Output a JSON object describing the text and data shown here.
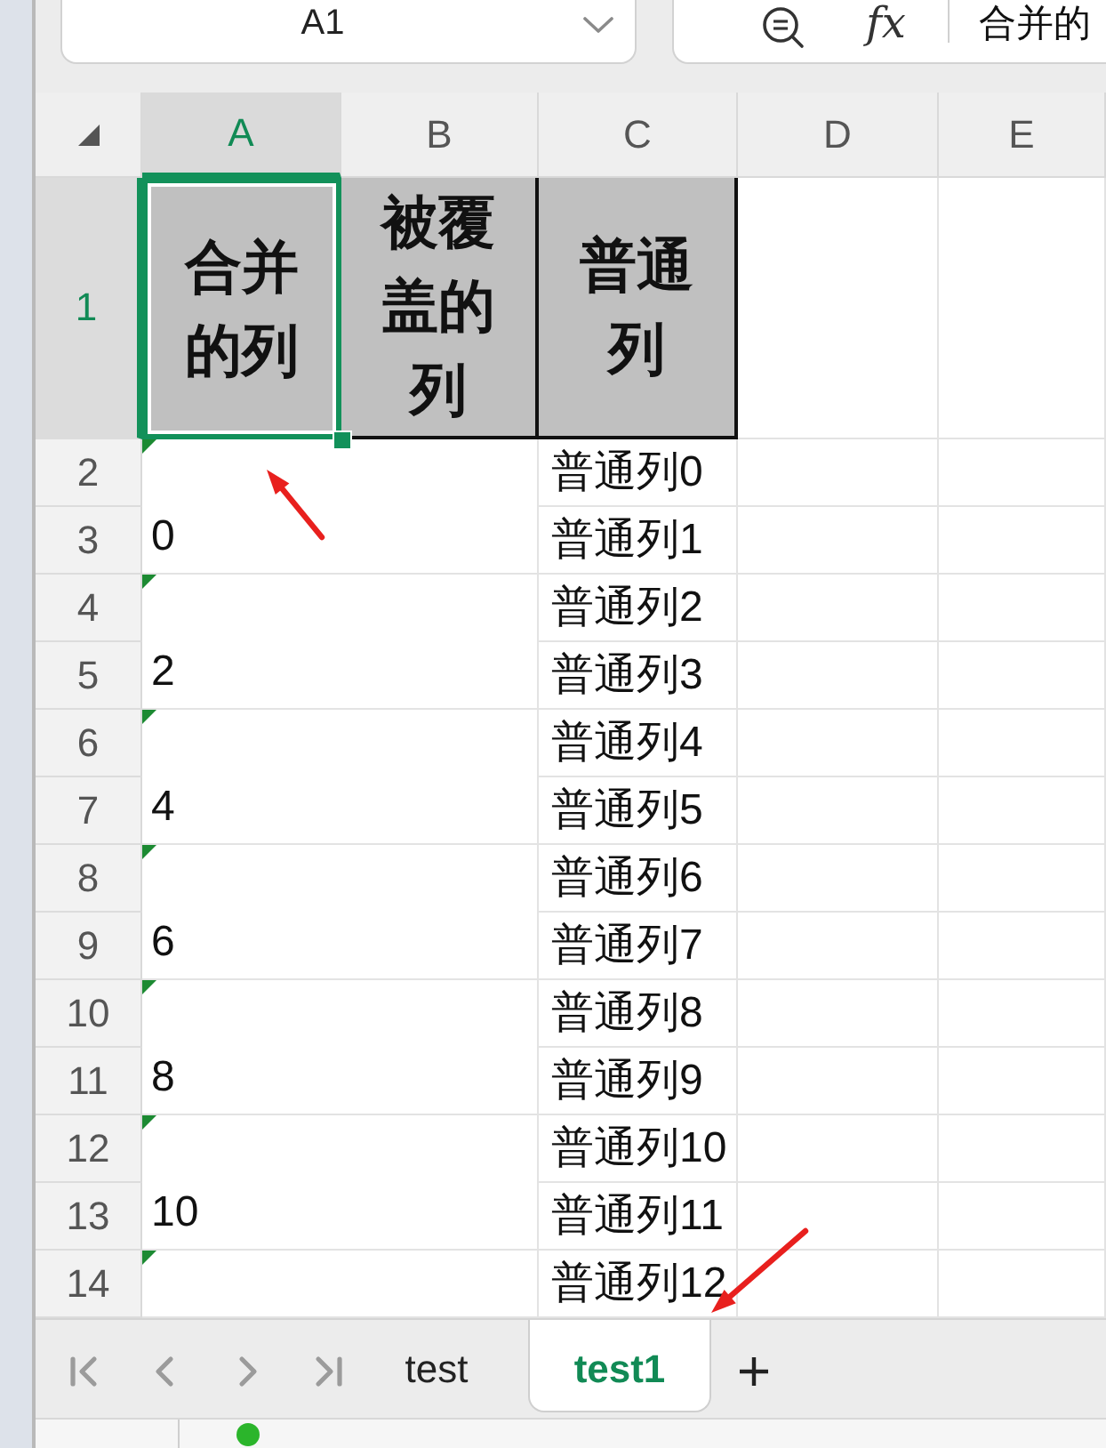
{
  "name_box": {
    "value": "A1"
  },
  "formula_bar": {
    "function_label": "fx",
    "value": "合并的"
  },
  "columns": [
    {
      "label": "A",
      "selected": true
    },
    {
      "label": "B",
      "selected": false
    },
    {
      "label": "C",
      "selected": false
    },
    {
      "label": "D",
      "selected": false
    },
    {
      "label": "E",
      "selected": false
    }
  ],
  "rows": [
    {
      "number": "1",
      "selected": true
    },
    {
      "number": "2",
      "selected": false
    },
    {
      "number": "3",
      "selected": false
    },
    {
      "number": "4",
      "selected": false
    },
    {
      "number": "5",
      "selected": false
    },
    {
      "number": "6",
      "selected": false
    },
    {
      "number": "7",
      "selected": false
    },
    {
      "number": "8",
      "selected": false
    },
    {
      "number": "9",
      "selected": false
    },
    {
      "number": "10",
      "selected": false
    },
    {
      "number": "11",
      "selected": false
    },
    {
      "number": "12",
      "selected": false
    },
    {
      "number": "13",
      "selected": false
    },
    {
      "number": "14",
      "selected": false
    }
  ],
  "header_cells": [
    {
      "text": "合并的列",
      "selected": true
    },
    {
      "text": "被覆盖的列",
      "selected": false
    },
    {
      "text": "普通列",
      "selected": false
    }
  ],
  "merged_cells": [
    {
      "value": "0",
      "flagged": true
    },
    {
      "value": "2",
      "flagged": true
    },
    {
      "value": "4",
      "flagged": true
    },
    {
      "value": "6",
      "flagged": true
    },
    {
      "value": "8",
      "flagged": true
    },
    {
      "value": "10",
      "flagged": true
    },
    {
      "flagged": true
    }
  ],
  "column_c_cells": [
    "普通列0",
    "普通列1",
    "普通列2",
    "普通列3",
    "普通列4",
    "普通列5",
    "普通列6",
    "普通列7",
    "普通列8",
    "普通列9",
    "普通列10",
    "普通列11",
    "普通列12"
  ],
  "sheet_tabs": [
    {
      "label": "test",
      "selected": false
    },
    {
      "label": "test1",
      "selected": true
    }
  ]
}
